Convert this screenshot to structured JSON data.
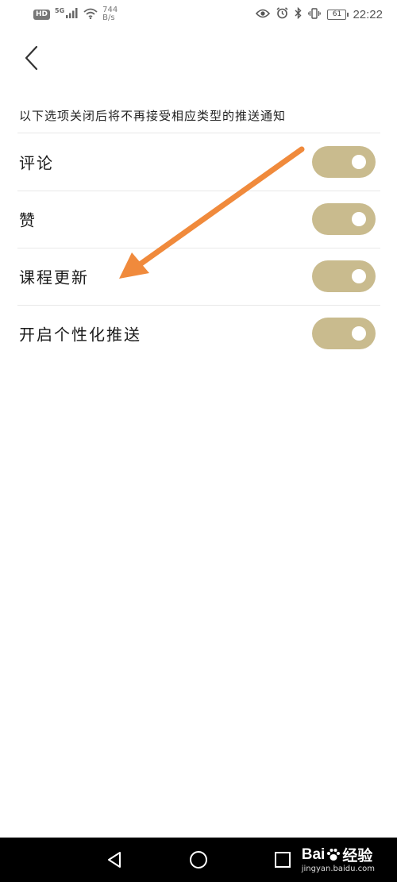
{
  "status_bar": {
    "hd_badge": "HD",
    "network_type": "5G",
    "net_speed_value": "744",
    "net_speed_unit": "B/s",
    "battery_level": "61",
    "time": "22:22"
  },
  "header": {
    "back_icon": "chevron-left-icon"
  },
  "description": "以下选项关闭后将不再接受相应类型的推送通知",
  "settings": [
    {
      "label": "评论",
      "enabled": true
    },
    {
      "label": "赞",
      "enabled": true
    },
    {
      "label": "课程更新",
      "enabled": true
    },
    {
      "label": "开启个性化推送",
      "enabled": true
    }
  ],
  "colors": {
    "toggle_on": "#c9bb8e",
    "arrow": "#f08a3c",
    "nav_bar": "#000000"
  },
  "nav_bar": {
    "back_icon": "triangle-back-icon",
    "home_icon": "circle-home-icon",
    "recents_icon": "square-recents-icon"
  },
  "watermark": {
    "brand_prefix": "Bai",
    "brand_suffix": "经验",
    "url": "jingyan.baidu.com"
  }
}
